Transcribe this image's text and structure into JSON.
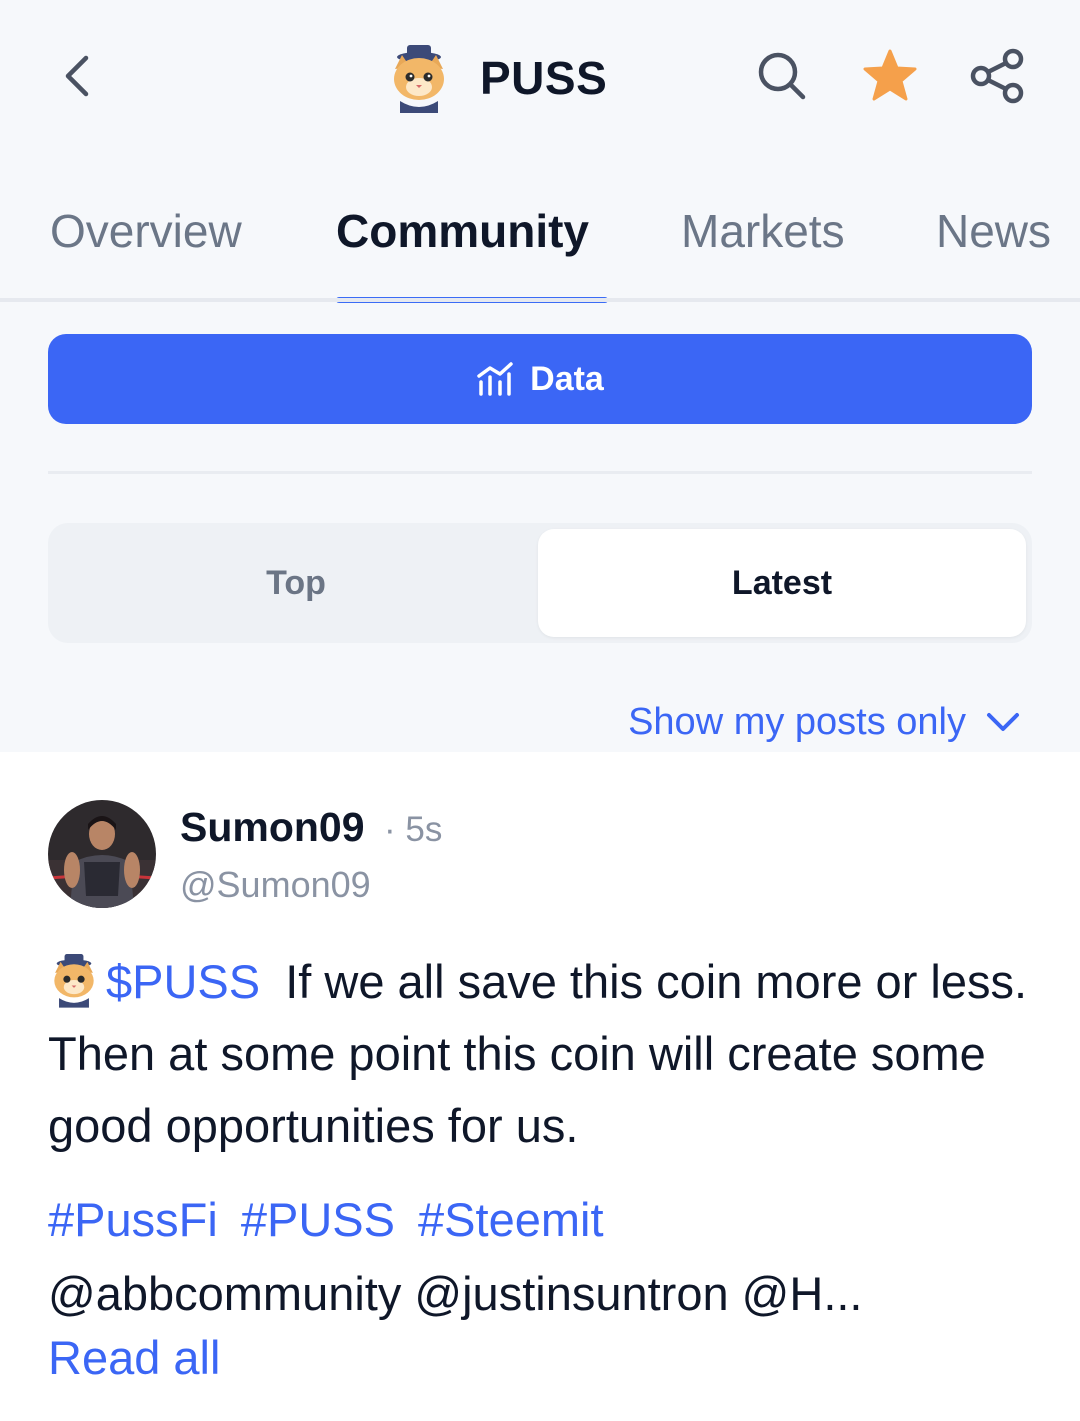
{
  "header": {
    "title": "PUSS",
    "back_icon": "chevron-left-icon",
    "search_icon": "search-icon",
    "star_icon": "star-icon",
    "share_icon": "share-icon",
    "star_color": "#f5a04b"
  },
  "tabs": [
    {
      "label": "Overview",
      "active": false
    },
    {
      "label": "Community",
      "active": true
    },
    {
      "label": "Markets",
      "active": false
    },
    {
      "label": "News",
      "active": false
    }
  ],
  "data_button": {
    "label": "Data",
    "icon": "chart-icon"
  },
  "segmented": {
    "top_label": "Top",
    "latest_label": "Latest",
    "selected": "Latest"
  },
  "filter": {
    "label": "Show my posts only",
    "icon": "chevron-down-icon"
  },
  "post": {
    "author_name": "Sumon09",
    "time": "· 5s",
    "handle": "@Sumon09",
    "cashtag": "$PUSS",
    "text": "If we all save this coin more or less. Then at some point this coin will create some good opportunities for us.",
    "hashtags": [
      "#PussFi",
      "#PUSS",
      "#Steemit"
    ],
    "mentions": "@abbcommunity @justinsuntron @H...",
    "read_all": "Read all"
  },
  "colors": {
    "accent": "#3b66f5",
    "text": "#0f1729",
    "muted": "#8a93a3",
    "background": "#f6f8fb"
  }
}
